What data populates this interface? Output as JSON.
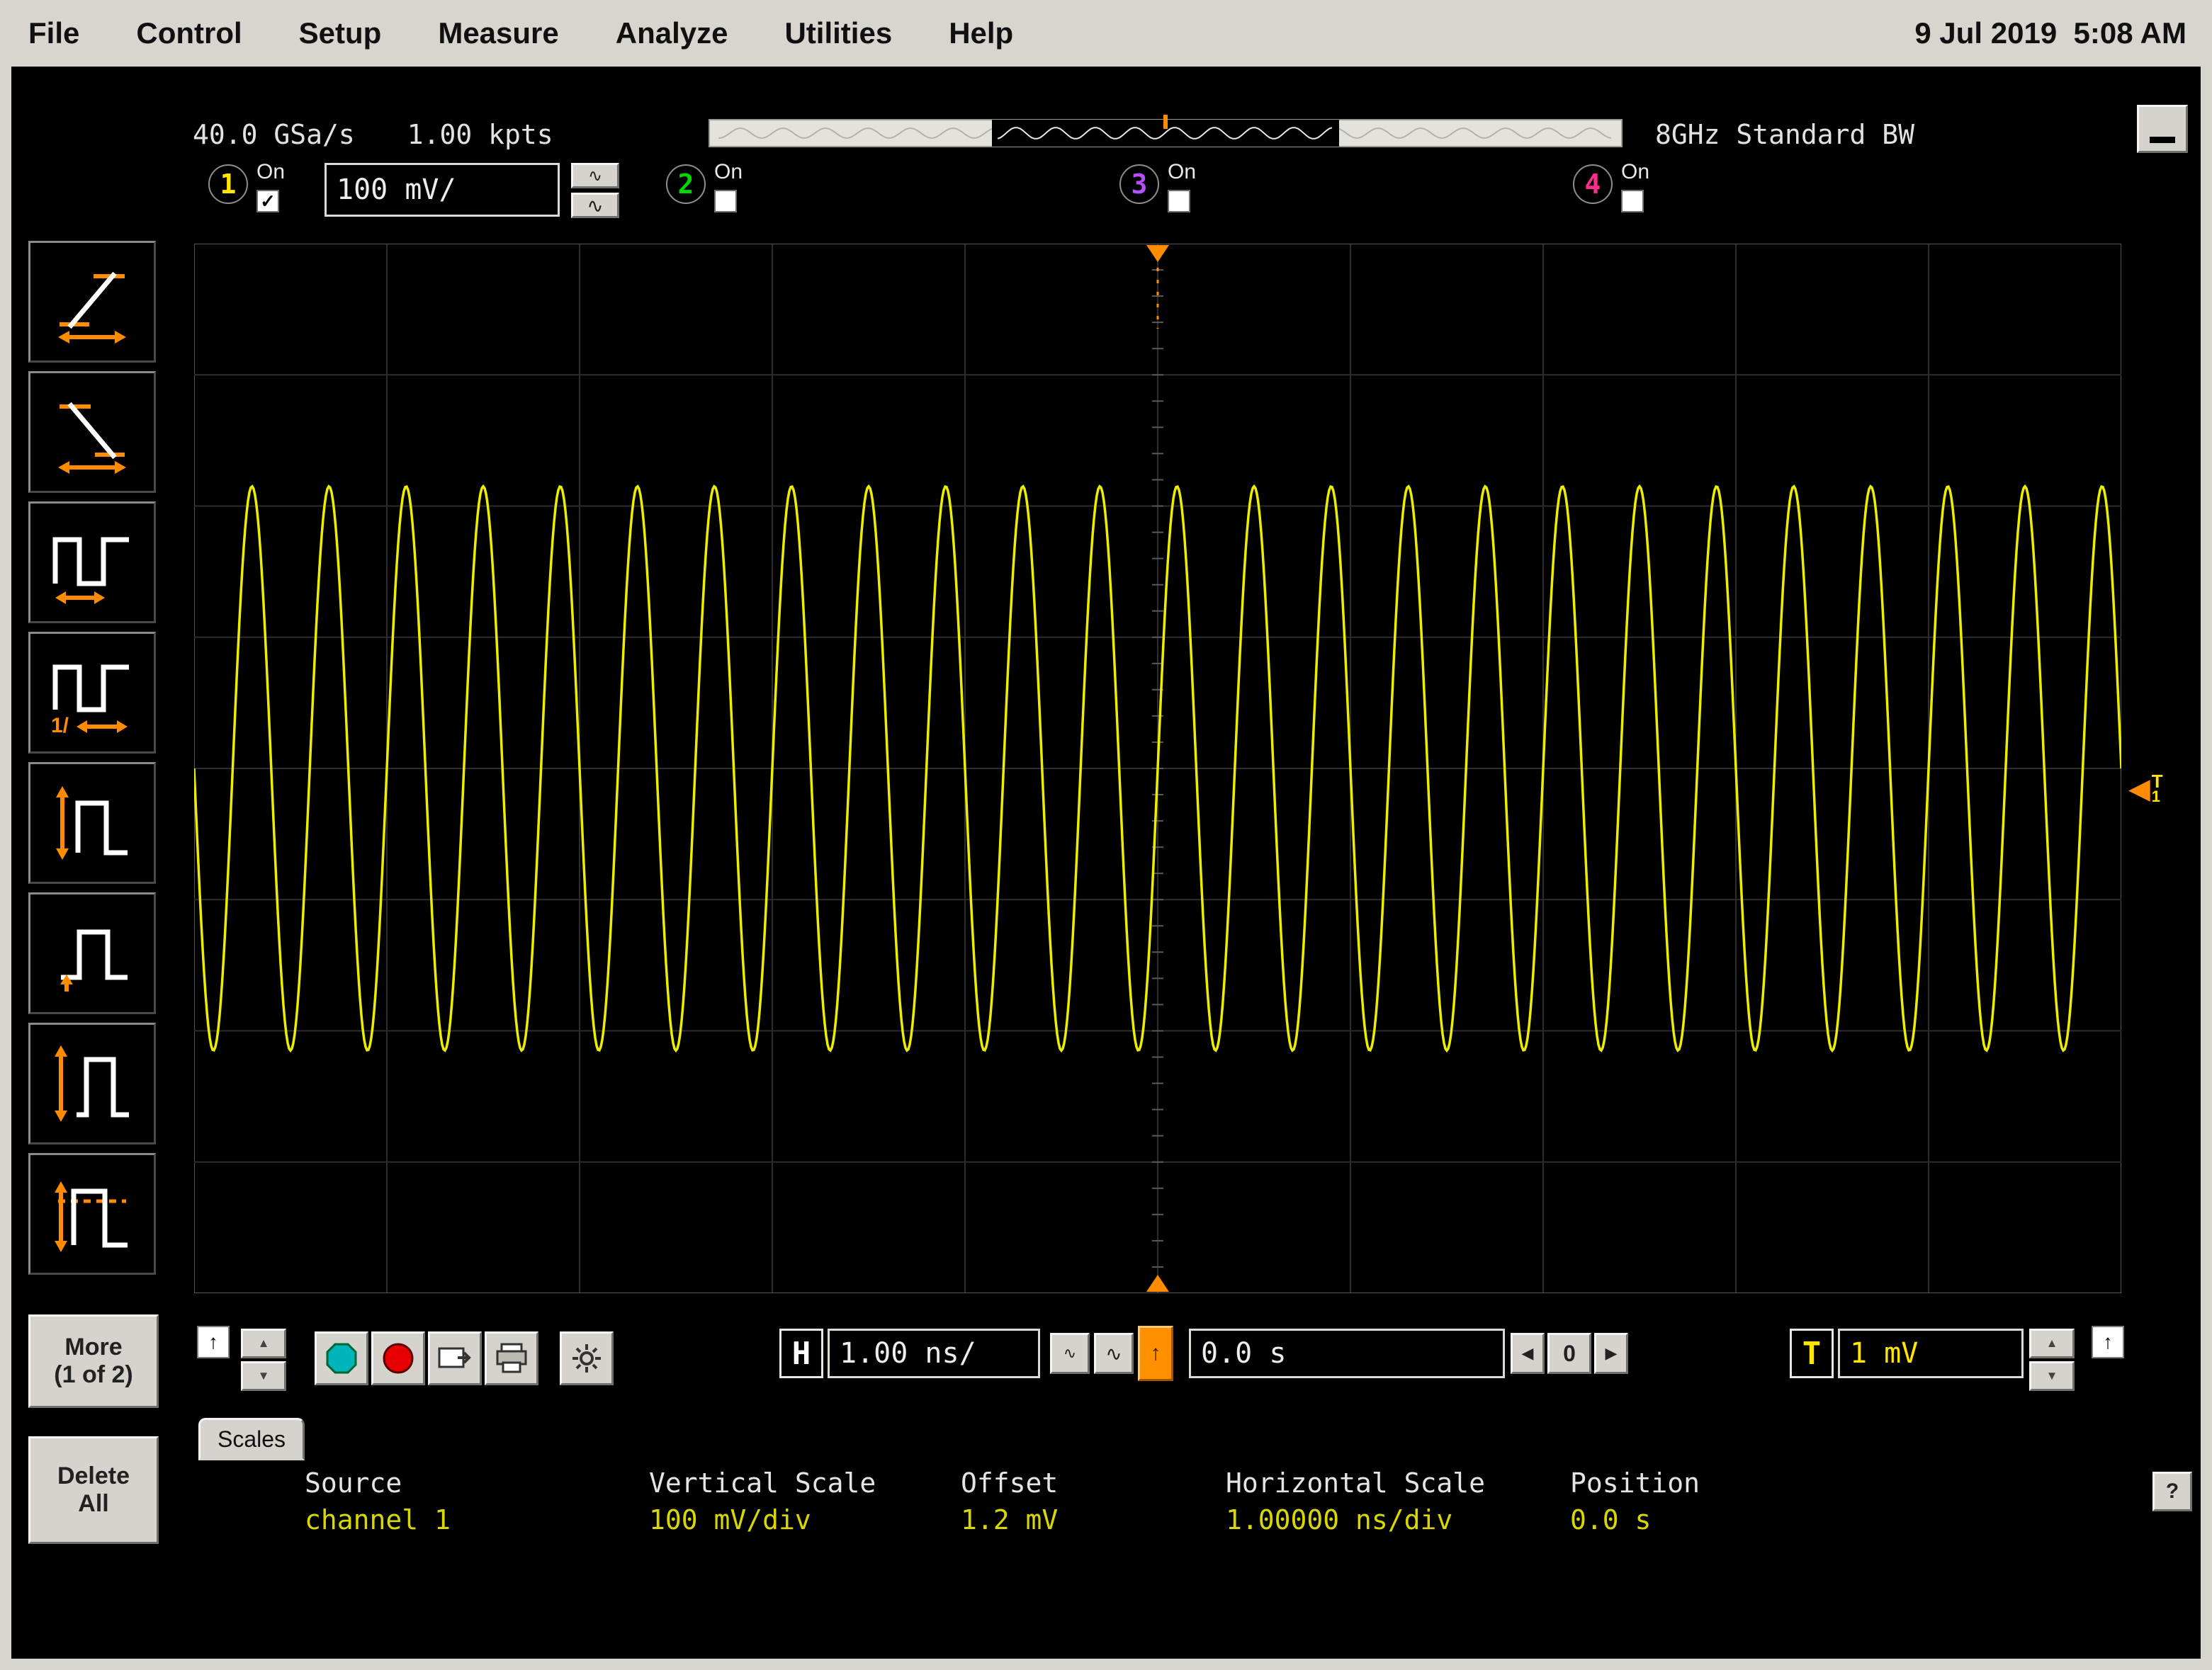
{
  "menu": {
    "items": [
      "File",
      "Control",
      "Setup",
      "Measure",
      "Analyze",
      "Utilities",
      "Help"
    ],
    "datetime": "9 Jul 2019  5:08 AM"
  },
  "status": {
    "sample_rate": "40.0 GSa/s",
    "memory_depth": "1.00 kpts",
    "bandwidth": "8GHz Standard BW"
  },
  "channels": [
    {
      "num": "1",
      "label_on": "On",
      "checked": "✓",
      "scale": "100 mV/",
      "color": "#ffe600"
    },
    {
      "num": "2",
      "label_on": "On",
      "checked": "",
      "color": "#00d800"
    },
    {
      "num": "3",
      "label_on": "On",
      "checked": "",
      "color": "#b450ff"
    },
    {
      "num": "4",
      "label_on": "On",
      "checked": "",
      "color": "#ff2e8e"
    }
  ],
  "sidebar": {
    "icons": [
      "rise-time",
      "fall-time",
      "period",
      "frequency",
      "v-peak-peak",
      "v-top",
      "v-amplitude",
      "v-overshoot"
    ],
    "freq_label": "1/",
    "more_line1": "More",
    "more_line2": "(1 of 2)",
    "delete_line1": "Delete",
    "delete_line2": "All"
  },
  "controls": {
    "h_key": "H",
    "timebase": "1.00 ns/",
    "h_position": "0.0 s",
    "left": "◀",
    "zero": "0",
    "right": "▶",
    "t_key": "T",
    "trigger_level": "1 mV"
  },
  "glyphs": {
    "ac_coupling": "∿",
    "arrow_up": "↑",
    "spinner_up": "▲",
    "spinner_down": "▼",
    "trigger_arrow": "◀"
  },
  "trigger_marker": {
    "t": "T",
    "channel": "1"
  },
  "scales": {
    "tab": "Scales",
    "help": "?",
    "headers": [
      "Source",
      "Vertical Scale",
      "Offset",
      "Horizontal Scale",
      "Position"
    ],
    "row": [
      "channel 1",
      "100 mV/div",
      "1.2 mV",
      "1.00000 ns/div",
      "0.0 s"
    ]
  },
  "chart_data": {
    "type": "line",
    "waveform": "sine",
    "channel": 1,
    "color": "#eded00",
    "grid": {
      "h_divisions": 10,
      "v_divisions": 8
    },
    "horizontal_scale_ns_per_div": 1.0,
    "vertical_scale_mv_per_div": 100,
    "time_span_ns": 10,
    "cycles_visible": 25,
    "frequency_ghz": 2.5,
    "amplitude_mv": 215,
    "offset_mv": 1.2,
    "trigger_level_mv": 1,
    "trigger_position": "0.0 s"
  }
}
